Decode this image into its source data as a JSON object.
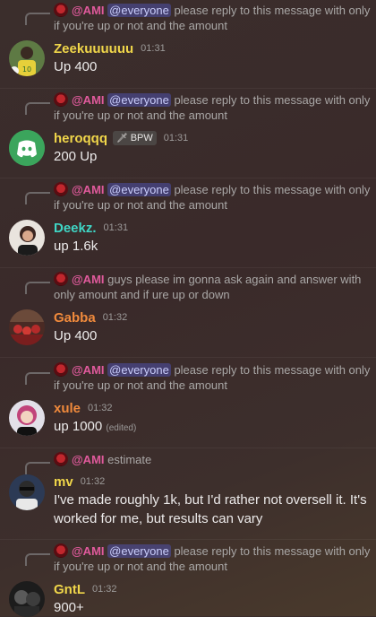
{
  "messages": [
    {
      "reply": {
        "author": "@AMI",
        "mention": "@everyone",
        "text": " please reply to this message with only if you're up or not and the amount"
      },
      "user": {
        "name": "Zeekuuuuuu",
        "color": "#f0d64a"
      },
      "time": "01:31",
      "content": "Up 400"
    },
    {
      "reply": {
        "author": "@AMI",
        "mention": "@everyone",
        "text": " please reply to this message with only if you're up or not and the amount"
      },
      "user": {
        "name": "heroqqq",
        "color": "#f0d64a"
      },
      "badge": "BPW",
      "time": "01:31",
      "content": "200 Up"
    },
    {
      "reply": {
        "author": "@AMI",
        "mention": "@everyone",
        "text": " please reply to this message with only if you're up or not and the amount"
      },
      "user": {
        "name": "Deekz.",
        "color": "#3fd6c5"
      },
      "time": "01:31",
      "content": "up 1.6k"
    },
    {
      "reply": {
        "author": "@AMI",
        "mention": "",
        "text": " guys please im gonna ask again and answer with only amount and if ure up or down"
      },
      "user": {
        "name": "Gabba",
        "color": "#f08a3c"
      },
      "time": "01:32",
      "content": "Up 400"
    },
    {
      "reply": {
        "author": "@AMI",
        "mention": "@everyone",
        "text": " please reply to this message with only if you're up or not and the amount"
      },
      "user": {
        "name": "xule",
        "color": "#f08a3c"
      },
      "time": "01:32",
      "content": "up 1000",
      "edited": "(edited)"
    },
    {
      "reply": {
        "author": "@AMI",
        "mention": "",
        "text": " estimate"
      },
      "user": {
        "name": "mv",
        "color": "#f0d64a"
      },
      "time": "01:32",
      "content": "I've made roughly 1k, but I'd rather not oversell it. It's worked for me, but results can vary"
    },
    {
      "reply": {
        "author": "@AMI",
        "mention": "@everyone",
        "text": " please reply to this message with only if you're up or not and the amount"
      },
      "user": {
        "name": "GntL",
        "color": "#f0d64a"
      },
      "time": "01:32",
      "content": "900+"
    }
  ]
}
